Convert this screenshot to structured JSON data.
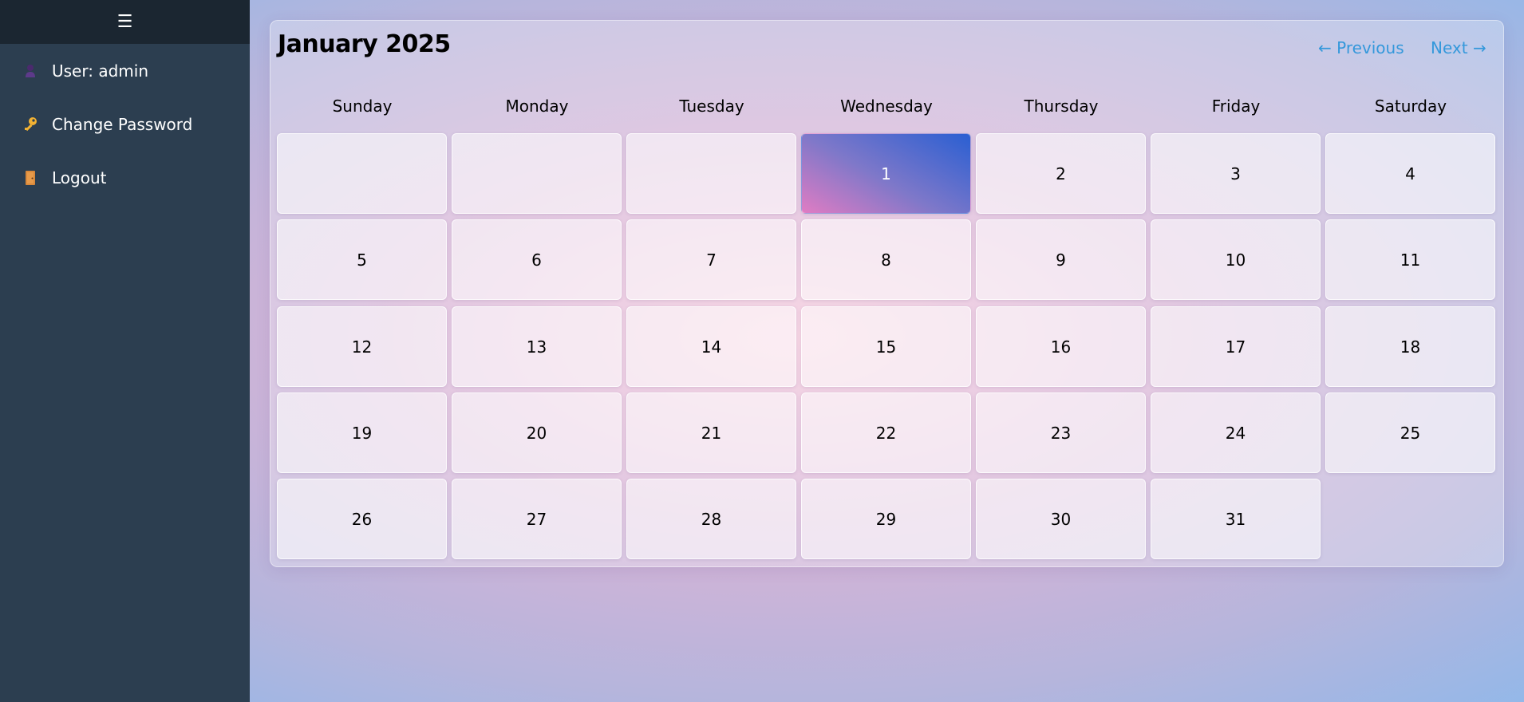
{
  "sidebar": {
    "menu_glyph": "☰",
    "items": [
      {
        "icon": "user-icon",
        "label": "User: admin"
      },
      {
        "icon": "key-icon",
        "label": "Change Password"
      },
      {
        "icon": "door-icon",
        "label": "Logout"
      }
    ]
  },
  "calendar": {
    "title": "January 2025",
    "prev_label": "← Previous",
    "next_label": "Next →",
    "weekdays": [
      "Sunday",
      "Monday",
      "Tuesday",
      "Wednesday",
      "Thursday",
      "Friday",
      "Saturday"
    ],
    "days": [
      "1",
      "2",
      "3",
      "4",
      "5",
      "6",
      "7",
      "8",
      "9",
      "10",
      "11",
      "12",
      "13",
      "14",
      "15",
      "16",
      "17",
      "18",
      "19",
      "20",
      "21",
      "22",
      "23",
      "24",
      "25",
      "26",
      "27",
      "28",
      "29",
      "30",
      "31"
    ],
    "highlighted_day": "1"
  },
  "colors": {
    "sidebar_bg": "#2c3e50",
    "sidebar_header_bg": "#1b2631",
    "link": "#3498db",
    "today_gradient": [
      "#e07cc3",
      "#2a5fd2"
    ]
  }
}
